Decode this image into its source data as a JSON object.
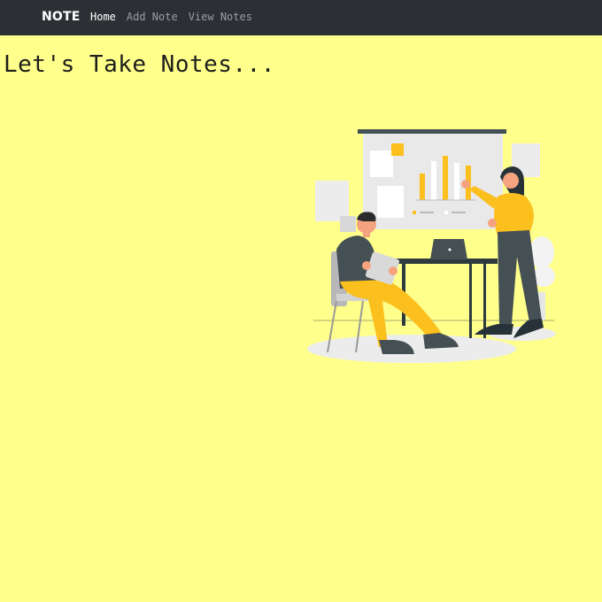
{
  "navbar": {
    "brand": "NOTE",
    "links": [
      {
        "label": "Home",
        "active": true
      },
      {
        "label": "Add Note",
        "active": false
      },
      {
        "label": "View Notes",
        "active": false
      }
    ]
  },
  "hero": {
    "title": "Let's Take Notes..."
  },
  "illustration": {
    "icon": "office-meeting-illustration"
  },
  "colors": {
    "page_background": "#ffff8b",
    "navbar_background": "#2c3034",
    "accent_yellow": "#fbbf1e",
    "dark_slate": "#455055"
  }
}
